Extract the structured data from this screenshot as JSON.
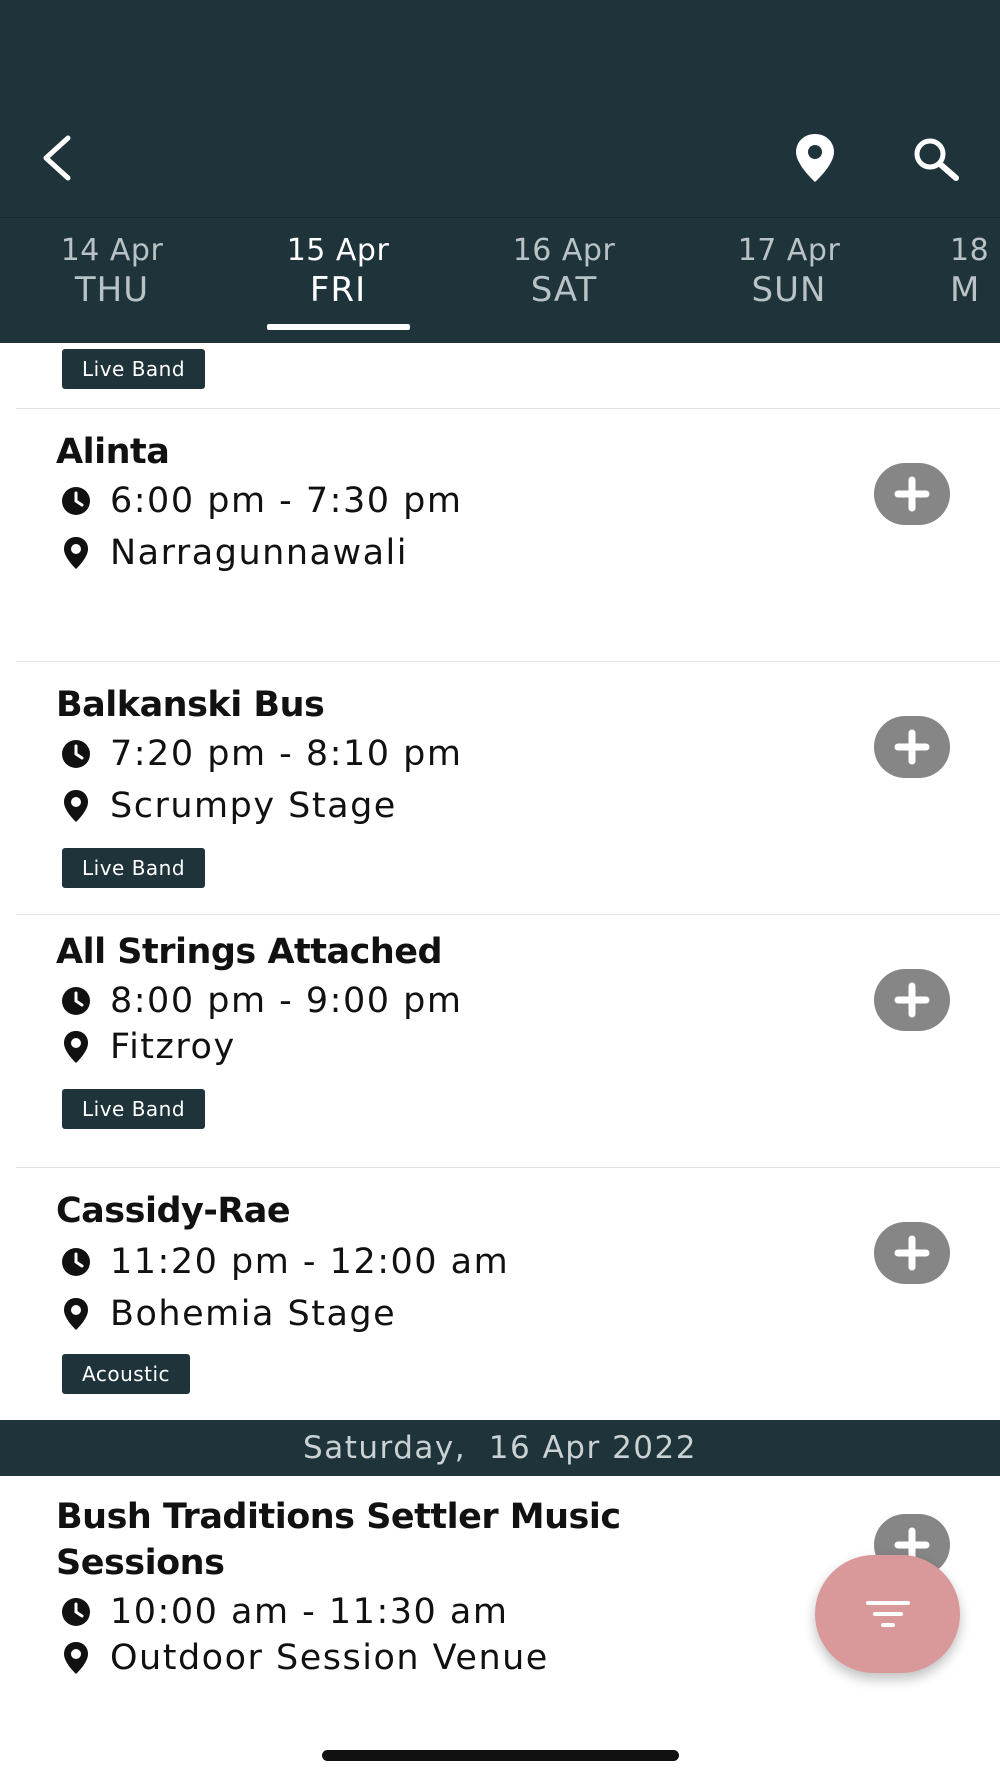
{
  "day_tabs": [
    {
      "date": "14 Apr",
      "day": "THU"
    },
    {
      "date": "15 Apr",
      "day": "FRI"
    },
    {
      "date": "16 Apr",
      "day": "SAT"
    },
    {
      "date": "17 Apr",
      "day": "SUN"
    },
    {
      "date": "18",
      "day": "M"
    }
  ],
  "active_tab": "15 Apr",
  "top_tag": "Live Band",
  "events": [
    {
      "title": "Alinta",
      "time": "6:00 pm - 7:30 pm",
      "venue": "Narragunnawali",
      "tag": ""
    },
    {
      "title": "Balkanski Bus",
      "time": "7:20 pm - 8:10 pm",
      "venue": "Scrumpy Stage",
      "tag": "Live Band"
    },
    {
      "title": "All Strings Attached",
      "time": "8:00 pm - 9:00 pm",
      "venue": "Fitzroy",
      "tag": "Live Band"
    },
    {
      "title": "Cassidy-Rae",
      "time": "11:20 pm - 12:00 am",
      "venue": "Bohemia Stage",
      "tag": "Acoustic"
    }
  ],
  "date_header": "Saturday,  16 Apr 2022",
  "next_event": {
    "title_line1": "Bush Traditions Settler Music",
    "title_line2": "Sessions",
    "time": "10:00 am - 11:30 am",
    "venue": "Outdoor Session Venue"
  },
  "icons": {
    "back": "chevron-left-icon",
    "location": "map-pin-icon",
    "search": "search-icon",
    "time": "clock-icon",
    "venue": "map-pin-icon",
    "add": "plus-icon",
    "filter": "filter-icon"
  },
  "colors": {
    "header_bg": "#1e333a",
    "add_button": "#868686",
    "fab": "#d9999b"
  }
}
